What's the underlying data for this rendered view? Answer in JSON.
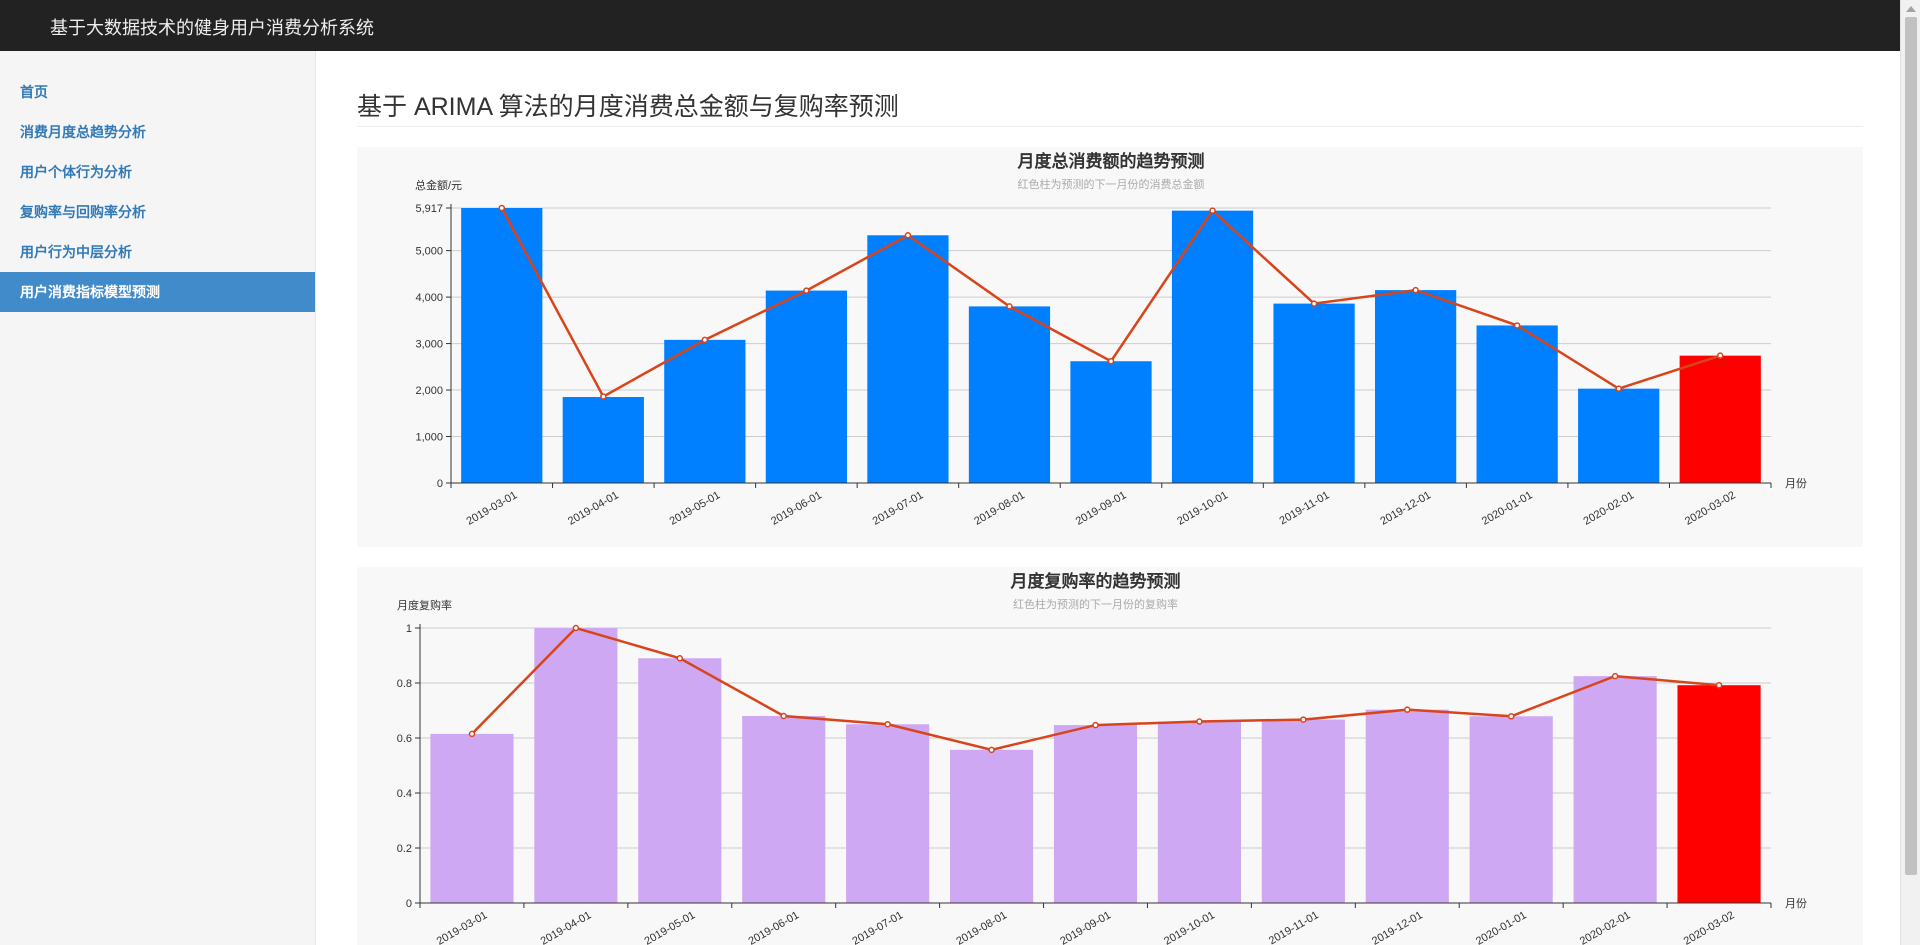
{
  "app": {
    "title": "基于大数据技术的健身用户消费分析系统"
  },
  "sidebar": {
    "items": [
      {
        "label": "首页",
        "active": false
      },
      {
        "label": "消费月度总趋势分析",
        "active": false
      },
      {
        "label": "用户个体行为分析",
        "active": false
      },
      {
        "label": "复购率与回购率分析",
        "active": false
      },
      {
        "label": "用户行为中层分析",
        "active": false
      },
      {
        "label": "用户消费指标模型预测",
        "active": true
      }
    ]
  },
  "page": {
    "title": "基于 ARIMA 算法的月度消费总金额与复购率预测"
  },
  "colors": {
    "bar": "#007fff",
    "bar2": "#cea8f3",
    "predicted": "#ff0000",
    "line": "#d9441a"
  },
  "chart_data": [
    {
      "type": "bar",
      "title": "月度总消费额的趋势预测",
      "subtitle": "红色柱为预测的下一月份的消费总金额",
      "ylabel": "总金额/元",
      "xlabel": "月份",
      "categories": [
        "2019-03-01",
        "2019-04-01",
        "2019-05-01",
        "2019-06-01",
        "2019-07-01",
        "2019-08-01",
        "2019-09-01",
        "2019-10-01",
        "2019-11-01",
        "2019-12-01",
        "2020-01-01",
        "2020-02-01",
        "2020-03-02"
      ],
      "values": [
        5917,
        1850,
        3080,
        4140,
        5330,
        3800,
        2620,
        5860,
        3860,
        4150,
        3390,
        2030,
        2740
      ],
      "line_values": [
        5917,
        1860,
        3080,
        4140,
        5330,
        3800,
        2620,
        5860,
        3860,
        4150,
        3390,
        2030,
        2740
      ],
      "predicted_index": 12,
      "yticks": [
        0,
        1000,
        2000,
        3000,
        4000,
        5000,
        5917
      ],
      "ytick_labels": [
        "0",
        "1,000",
        "2,000",
        "3,000",
        "4,000",
        "5,000",
        "5,917"
      ],
      "ylim": [
        0,
        5917
      ],
      "grid": true
    },
    {
      "type": "bar",
      "title": "月度复购率的趋势预测",
      "subtitle": "红色柱为预测的下一月份的复购率",
      "ylabel": "月度复购率",
      "xlabel": "月份",
      "categories": [
        "2019-03-01",
        "2019-04-01",
        "2019-05-01",
        "2019-06-01",
        "2019-07-01",
        "2019-08-01",
        "2019-09-01",
        "2019-10-01",
        "2019-11-01",
        "2019-12-01",
        "2020-01-01",
        "2020-02-01",
        "2020-03-02"
      ],
      "values": [
        0.615,
        1.0,
        0.89,
        0.68,
        0.65,
        0.557,
        0.647,
        0.66,
        0.667,
        0.703,
        0.679,
        0.825,
        0.792
      ],
      "line_values": [
        0.615,
        1.0,
        0.89,
        0.68,
        0.65,
        0.557,
        0.647,
        0.66,
        0.667,
        0.703,
        0.679,
        0.825,
        0.792
      ],
      "predicted_index": 12,
      "yticks": [
        0,
        0.2,
        0.4,
        0.6,
        0.8,
        1
      ],
      "ytick_labels": [
        "0",
        "0.2",
        "0.4",
        "0.6",
        "0.8",
        "1"
      ],
      "ylim": [
        0,
        1
      ],
      "grid": true
    }
  ]
}
